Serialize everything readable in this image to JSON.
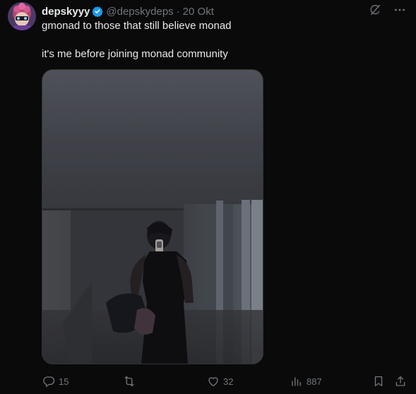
{
  "post": {
    "author_name": "depskyyy",
    "author_handle": "@depskydeps",
    "separator": "·",
    "date": "20 Okt",
    "text_line1": "gmonad to those that still believe monad",
    "text_line2": "it's me before joining monad community"
  },
  "header_icons": [
    "grok-icon",
    "more-icon"
  ],
  "actions": {
    "replies": "15",
    "reposts": "",
    "likes": "32",
    "views": "887"
  },
  "colors": {
    "background": "#0a0a0b",
    "text": "#e7e9ea",
    "muted": "#71767b",
    "verified": "#1d9bf0"
  }
}
